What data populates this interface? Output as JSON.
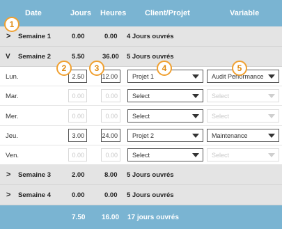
{
  "header": {
    "date": "Date",
    "jours": "Jours",
    "heures": "Heures",
    "client_projet": "Client/Projet",
    "variable": "Variable"
  },
  "weeks": [
    {
      "label": "Semaine 1",
      "jours": "0.00",
      "heures": "0.00",
      "ouvres": "4 Jours ouvrés",
      "expanded": false
    },
    {
      "label": "Semaine 2",
      "jours": "5.50",
      "heures": "36.00",
      "ouvres": "5 Jours ouvrés",
      "expanded": true
    },
    {
      "label": "Semaine 3",
      "jours": "2.00",
      "heures": "8.00",
      "ouvres": "5 Jours ouvrés",
      "expanded": false
    },
    {
      "label": "Semaine 4",
      "jours": "0.00",
      "heures": "0.00",
      "ouvres": "5 Jours ouvrés",
      "expanded": false
    }
  ],
  "days": [
    {
      "label": "Lun.",
      "jours": "2.50",
      "heures": "12.00",
      "projet": "Projet 1",
      "variable": "Audit Performance",
      "enabled": true
    },
    {
      "label": "Mar.",
      "jours": "0.00",
      "heures": "0.00",
      "projet": "Select",
      "variable": "Select",
      "enabled": false
    },
    {
      "label": "Mer.",
      "jours": "0.00",
      "heures": "0.00",
      "projet": "Select",
      "variable": "Select",
      "enabled": false
    },
    {
      "label": "Jeu.",
      "jours": "3.00",
      "heures": "24.00",
      "projet": "Projet 2",
      "variable": "Maintenance",
      "enabled": true
    },
    {
      "label": "Ven.",
      "jours": "0.00",
      "heures": "0.00",
      "projet": "Select",
      "variable": "Select",
      "enabled": false
    }
  ],
  "footer": {
    "jours": "7.50",
    "heures": "16.00",
    "ouvres": "17 jours ouvrés"
  },
  "badges": [
    "1",
    "2",
    "3",
    "4",
    "5"
  ],
  "colors": {
    "header_bg": "#7ab4d2",
    "week_bg": "#e4e4e4",
    "badge": "#f0a030"
  },
  "icons": {
    "collapsed": "chevron-right-icon",
    "expanded": "chevron-down-icon",
    "dropdown": "caret-down-icon"
  }
}
